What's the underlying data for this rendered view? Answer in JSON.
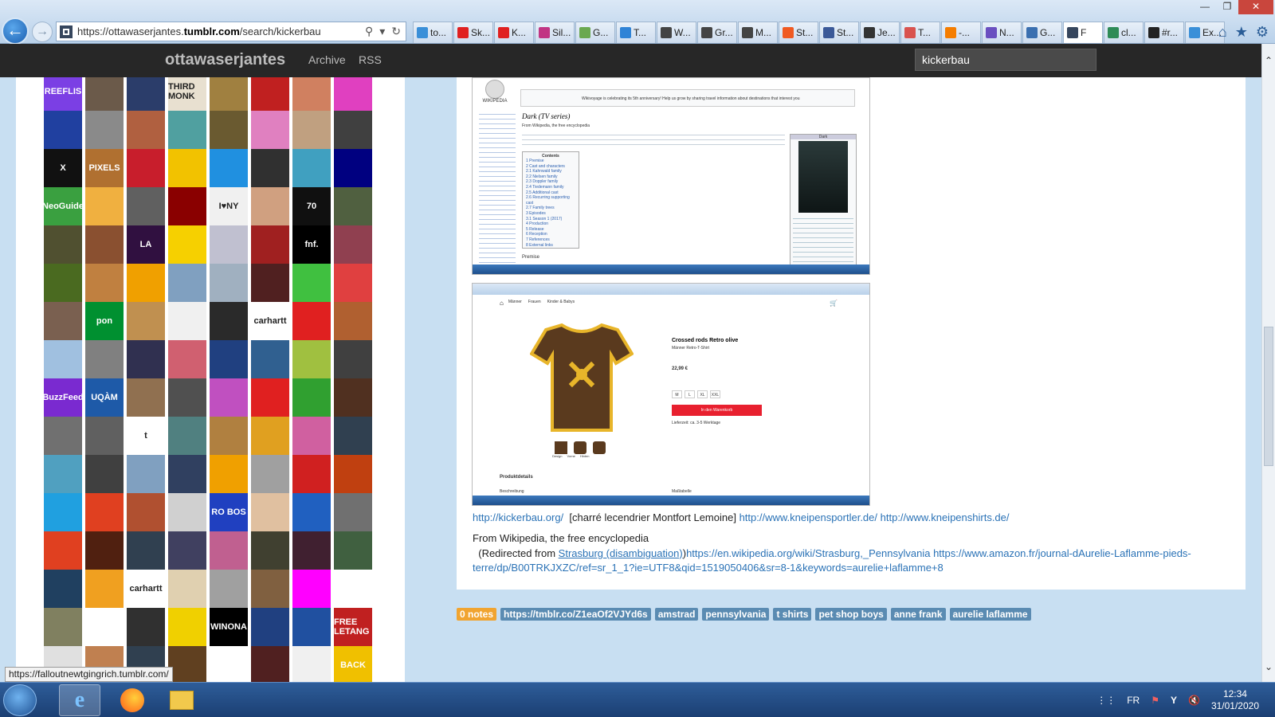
{
  "browser": {
    "url_prefix": "https://ottawaserjantes.",
    "url_domain": "tumblr.com",
    "url_suffix": "/search/kickerbau",
    "tabs": [
      {
        "label": "to...",
        "color": "#3a8fd8"
      },
      {
        "label": "Sk...",
        "color": "#e02020"
      },
      {
        "label": "K...",
        "color": "#e02020"
      },
      {
        "label": "Sil...",
        "color": "#c13584"
      },
      {
        "label": "G...",
        "color": "#6aa84f"
      },
      {
        "label": "T...",
        "color": "#2f83d6"
      },
      {
        "label": "W...",
        "color": "#444444"
      },
      {
        "label": "Gr...",
        "color": "#444444"
      },
      {
        "label": "M...",
        "color": "#444444"
      },
      {
        "label": "St...",
        "color": "#f05a22"
      },
      {
        "label": "St...",
        "color": "#3b5998"
      },
      {
        "label": "Je...",
        "color": "#333333"
      },
      {
        "label": "T...",
        "color": "#d9534f"
      },
      {
        "label": "-...",
        "color": "#f57d00"
      },
      {
        "label": "N...",
        "color": "#6a4fc0"
      },
      {
        "label": "G...",
        "color": "#3a6fb0"
      },
      {
        "label": "F",
        "color": "#36465d",
        "active": true
      },
      {
        "label": "cl...",
        "color": "#2e8b57"
      },
      {
        "label": "#r...",
        "color": "#222222"
      },
      {
        "label": "Ex...",
        "color": "#3a8fd8"
      }
    ]
  },
  "blog": {
    "title": "ottawaserjantes",
    "nav_archive": "Archive",
    "nav_rss": "RSS",
    "search_value": "kickerbau"
  },
  "avatars": [
    {
      "c": "#7b3fe4",
      "t": "REEFLIS"
    },
    {
      "c": "#6b5a4a",
      "t": ""
    },
    {
      "c": "#2b3d6a",
      "t": ""
    },
    {
      "c": "#e8e0d0",
      "t": "THIRD MONK"
    },
    {
      "c": "#a08040",
      "t": ""
    },
    {
      "c": "#c02020",
      "t": ""
    },
    {
      "c": "#d08060",
      "t": ""
    },
    {
      "c": "#e040c0",
      "t": ""
    },
    {
      "c": "#2040a0",
      "t": ""
    },
    {
      "c": "#8a8a8a",
      "t": ""
    },
    {
      "c": "#b06040",
      "t": ""
    },
    {
      "c": "#50a0a0",
      "t": ""
    },
    {
      "c": "#6a5a30",
      "t": ""
    },
    {
      "c": "#e080c0",
      "t": ""
    },
    {
      "c": "#c0a080",
      "t": ""
    },
    {
      "c": "#404040",
      "t": ""
    },
    {
      "c": "#111111",
      "t": "X"
    },
    {
      "c": "#b07030",
      "t": "PIXELS"
    },
    {
      "c": "#c81e2c",
      "t": ""
    },
    {
      "c": "#f2c200",
      "t": ""
    },
    {
      "c": "#2090e0",
      "t": ""
    },
    {
      "c": "#303030",
      "t": ""
    },
    {
      "c": "#40a0c0",
      "t": ""
    },
    {
      "c": "#000080",
      "t": ""
    },
    {
      "c": "#3aa040",
      "t": "NeoGuide"
    },
    {
      "c": "#f0b040",
      "t": ""
    },
    {
      "c": "#606060",
      "t": ""
    },
    {
      "c": "#8a0000",
      "t": ""
    },
    {
      "c": "#f0f0f0",
      "t": "I♥NY"
    },
    {
      "c": "#d0a080",
      "t": ""
    },
    {
      "c": "#101010",
      "t": "70"
    },
    {
      "c": "#506040",
      "t": ""
    },
    {
      "c": "#505030",
      "t": ""
    },
    {
      "c": "#8a5030",
      "t": ""
    },
    {
      "c": "#301040",
      "t": "LA"
    },
    {
      "c": "#f6d000",
      "t": ""
    },
    {
      "c": "#c0c0d0",
      "t": ""
    },
    {
      "c": "#a02020",
      "t": ""
    },
    {
      "c": "#000000",
      "t": "fnf."
    },
    {
      "c": "#904050",
      "t": ""
    },
    {
      "c": "#4a6a20",
      "t": ""
    },
    {
      "c": "#c08040",
      "t": ""
    },
    {
      "c": "#f0a000",
      "t": ""
    },
    {
      "c": "#80a0c0",
      "t": ""
    },
    {
      "c": "#a0b0c0",
      "t": ""
    },
    {
      "c": "#502020",
      "t": ""
    },
    {
      "c": "#40c040",
      "t": ""
    },
    {
      "c": "#e04040",
      "t": ""
    },
    {
      "c": "#7a6050",
      "t": ""
    },
    {
      "c": "#009030",
      "t": "pon"
    },
    {
      "c": "#c09050",
      "t": ""
    },
    {
      "c": "#f0f0f0",
      "t": ""
    },
    {
      "c": "#2a2a2a",
      "t": ""
    },
    {
      "c": "#ffffff",
      "t": "carhartt"
    },
    {
      "c": "#e02020",
      "t": ""
    },
    {
      "c": "#b06030",
      "t": ""
    },
    {
      "c": "#a0c0e0",
      "t": ""
    },
    {
      "c": "#808080",
      "t": ""
    },
    {
      "c": "#303050",
      "t": ""
    },
    {
      "c": "#d06070",
      "t": ""
    },
    {
      "c": "#204080",
      "t": ""
    },
    {
      "c": "#306090",
      "t": ""
    },
    {
      "c": "#a0c040",
      "t": ""
    },
    {
      "c": "#404040",
      "t": ""
    },
    {
      "c": "#7a2ad0",
      "t": "BuzzFeed"
    },
    {
      "c": "#1e5aa8",
      "t": "UQÀM"
    },
    {
      "c": "#907050",
      "t": ""
    },
    {
      "c": "#505050",
      "t": ""
    },
    {
      "c": "#c050c0",
      "t": ""
    },
    {
      "c": "#e02020",
      "t": ""
    },
    {
      "c": "#30a030",
      "t": ""
    },
    {
      "c": "#503020",
      "t": ""
    },
    {
      "c": "#707070",
      "t": ""
    },
    {
      "c": "#606060",
      "t": ""
    },
    {
      "c": "#ffffff",
      "t": "t"
    },
    {
      "c": "#508080",
      "t": ""
    },
    {
      "c": "#b08040",
      "t": ""
    },
    {
      "c": "#e0a020",
      "t": ""
    },
    {
      "c": "#d060a0",
      "t": ""
    },
    {
      "c": "#304050",
      "t": ""
    },
    {
      "c": "#50a0c0",
      "t": ""
    },
    {
      "c": "#404040",
      "t": ""
    },
    {
      "c": "#80a0c0",
      "t": ""
    },
    {
      "c": "#304060",
      "t": ""
    },
    {
      "c": "#f0a000",
      "t": ""
    },
    {
      "c": "#a0a0a0",
      "t": ""
    },
    {
      "c": "#d02020",
      "t": ""
    },
    {
      "c": "#c04010",
      "t": ""
    },
    {
      "c": "#20a0e0",
      "t": ""
    },
    {
      "c": "#e04020",
      "t": ""
    },
    {
      "c": "#b05030",
      "t": ""
    },
    {
      "c": "#d0d0d0",
      "t": ""
    },
    {
      "c": "#2040c0",
      "t": "RO BOS"
    },
    {
      "c": "#e0c0a0",
      "t": ""
    },
    {
      "c": "#2060c0",
      "t": ""
    },
    {
      "c": "#707070",
      "t": ""
    },
    {
      "c": "#e04020",
      "t": ""
    },
    {
      "c": "#502010",
      "t": ""
    },
    {
      "c": "#304050",
      "t": ""
    },
    {
      "c": "#404060",
      "t": ""
    },
    {
      "c": "#c06090",
      "t": ""
    },
    {
      "c": "#404030",
      "t": ""
    },
    {
      "c": "#402030",
      "t": ""
    },
    {
      "c": "#406040",
      "t": ""
    },
    {
      "c": "#204060",
      "t": ""
    },
    {
      "c": "#f0a020",
      "t": ""
    },
    {
      "c": "#ffffff",
      "t": "carhartt"
    },
    {
      "c": "#e0d0b0",
      "t": ""
    },
    {
      "c": "#a0a0a0",
      "t": ""
    },
    {
      "c": "#806040",
      "t": ""
    },
    {
      "c": "#ff00ff",
      "t": ""
    },
    {
      "c": "#ffffff",
      "t": ""
    },
    {
      "c": "#808060",
      "t": ""
    },
    {
      "c": "#ffffff",
      "t": ""
    },
    {
      "c": "#303030",
      "t": ""
    },
    {
      "c": "#f0d000",
      "t": ""
    },
    {
      "c": "#000000",
      "t": "WINONA"
    },
    {
      "c": "#204080",
      "t": ""
    },
    {
      "c": "#2050a0",
      "t": ""
    },
    {
      "c": "#c02020",
      "t": "FREE LETANG"
    },
    {
      "c": "#e0e0e0",
      "t": ""
    },
    {
      "c": "#c08050",
      "t": ""
    },
    {
      "c": "#304050",
      "t": ""
    },
    {
      "c": "#604020",
      "t": ""
    },
    {
      "c": "#ffffff",
      "t": ""
    },
    {
      "c": "#502020",
      "t": ""
    },
    {
      "c": "#f0f0f0",
      "t": ""
    },
    {
      "c": "#f0c000",
      "t": "BACK"
    }
  ],
  "post": {
    "link1": "http://kickerbau.org/",
    "middle_text": "[charré lecendrier Montfort Lemoine]",
    "link2": "http://www.kneipensportler.de/",
    "link3": "http://www.kneipenshirts.de/",
    "wiki_line": "From Wikipedia, the free encyclopedia",
    "redirect_prefix": "(Redirected from ",
    "redirect_link": "Strasburg (disambiguation)",
    "redirect_close": ")",
    "links_long": "https://en.wikipedia.org/wiki/Strasburg,_Pennsylvania https://www.amazon.fr/journal-dAurelie-Laflamme-pieds-terre/dp/B00TRKJXZC/ref=sr_1_1?ie=UTF8&qid=1519050406&sr=8-1&keywords=aurelie+laflamme+8"
  },
  "wiki_shot": {
    "logo": "WIKIPEDIA",
    "banner": "Wikivoyage is celebrating its 5th anniversary! Help us grow by sharing travel information about destinations that interest you",
    "heading": "Dark (TV series)",
    "from": "From Wikipedia, the free encyclopedia",
    "infobox_title": "Dark",
    "contents_title": "Contents",
    "contents": [
      "1 Premise",
      "2 Cast and characters",
      "2.1 Kahnwald family",
      "2.2 Nielsen family",
      "2.3 Doppler family",
      "2.4 Tiedemann family",
      "2.5 Additional cast",
      "2.6 Recurring supporting cast",
      "2.7 Family trees",
      "3 Episodes",
      "3.1 Season 1 (2017)",
      "4 Production",
      "5 Release",
      "6 Reception",
      "7 References",
      "8 External links"
    ],
    "premise": "Premise"
  },
  "shop_shot": {
    "nav": [
      "Männer",
      "Frauen",
      "Kinder & Babys"
    ],
    "product_title": "Crossed rods Retro olive",
    "subtitle": "Männer Retro-T-Shirt",
    "price": "22,99 €",
    "sizes": [
      "M",
      "L",
      "XL",
      "XXL"
    ],
    "cart_button": "In den Warenkorb",
    "delivery": "Lieferzeit: ca. 3-5 Werktage",
    "thumbs": [
      "Design",
      "Vorne",
      "Hinten"
    ],
    "details": "Produktdetails",
    "desc": "Beschreibung",
    "size_table": "Maßtabelle"
  },
  "tags": [
    "0 notes",
    "https://tmblr.co/Z1eaOf2VJYd6s",
    "amstrad",
    "pennsylvania",
    "t shirts",
    "pet shop boys",
    "anne frank",
    "aurelie laflamme"
  ],
  "status_url": "https://falloutnewtgingrich.tumblr.com/",
  "taskbar": {
    "lang": "FR",
    "time": "12:34",
    "date": "31/01/2020"
  }
}
